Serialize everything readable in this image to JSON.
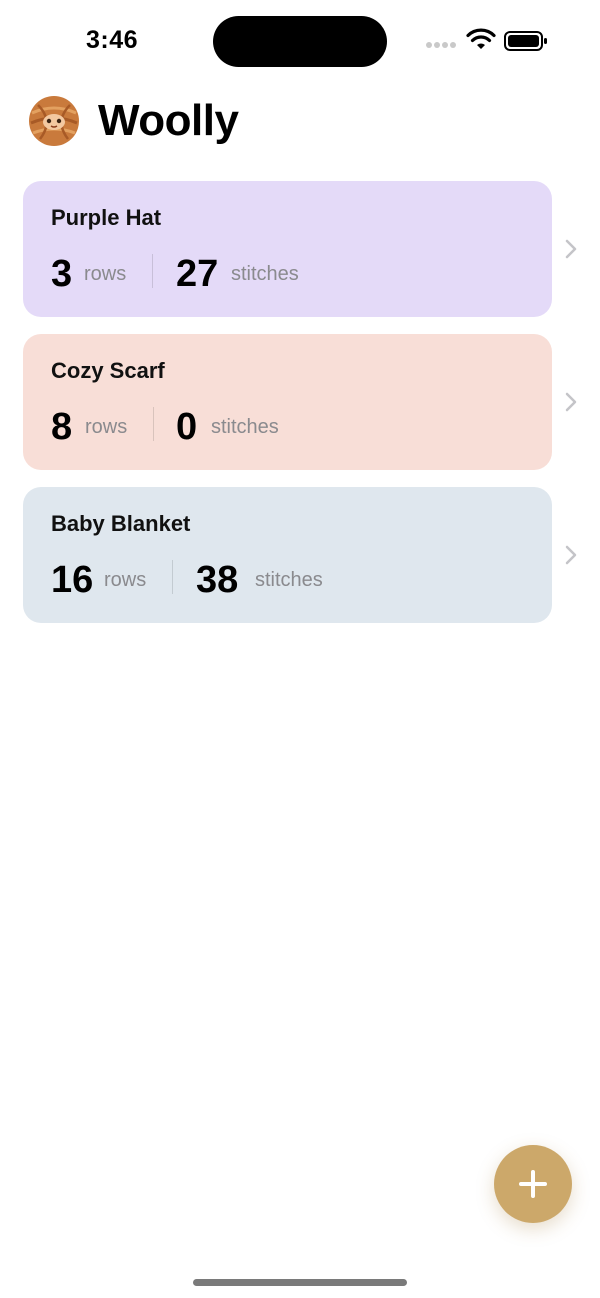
{
  "status_bar": {
    "time": "3:46"
  },
  "header": {
    "title": "Woolly",
    "logo_icon": "yarn-ball-mascot-icon"
  },
  "projects": [
    {
      "name": "Purple Hat",
      "rows": "3",
      "rows_unit": "rows",
      "stitches": "27",
      "stitches_unit": "stitches",
      "color": "#e4daf8"
    },
    {
      "name": "Cozy Scarf",
      "rows": "8",
      "rows_unit": "rows",
      "stitches": "0",
      "stitches_unit": "stitches",
      "color": "#f8ded7"
    },
    {
      "name": "Baby Blanket",
      "rows": "16",
      "rows_unit": "rows",
      "stitches": "38",
      "stitches_unit": "stitches",
      "color": "#dfe7ee"
    }
  ],
  "fab": {
    "icon": "plus-icon",
    "color": "#cca86a"
  }
}
